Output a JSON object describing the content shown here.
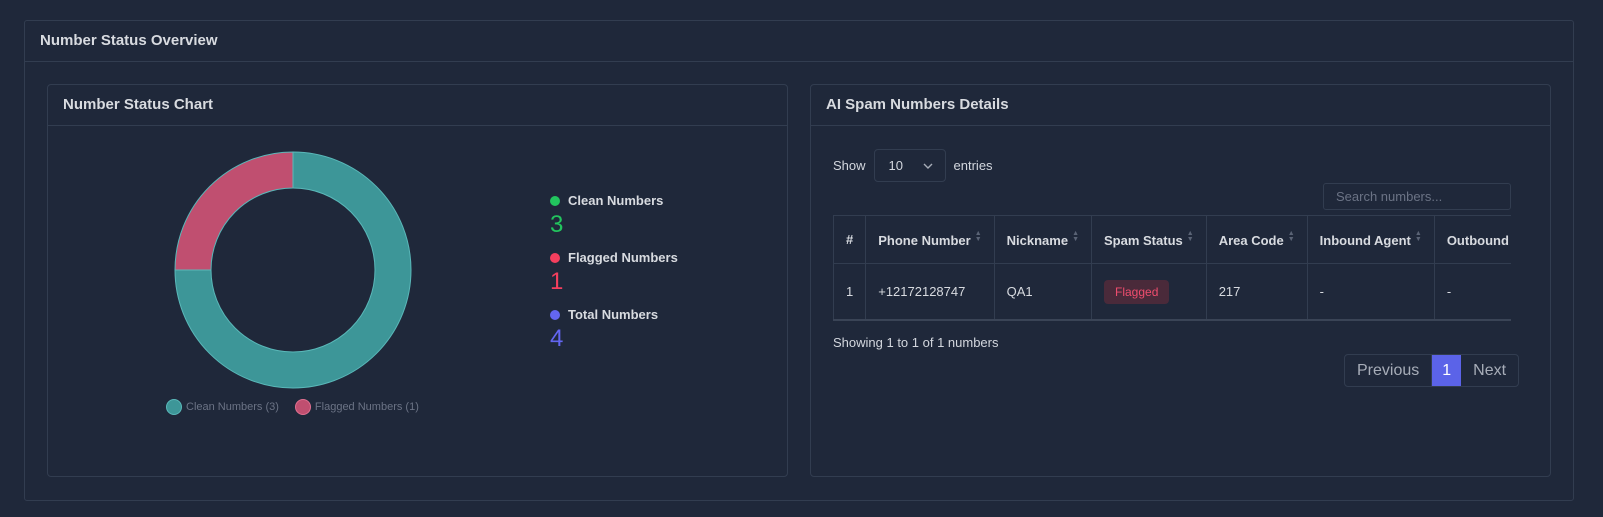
{
  "overview": {
    "title": "Number Status Overview"
  },
  "chart_card": {
    "title": "Number Status Chart",
    "legend": [
      {
        "label": "Clean Numbers (3)",
        "color": "#3d9698"
      },
      {
        "label": "Flagged Numbers (1)",
        "color": "#c04f70"
      }
    ]
  },
  "chart_data": {
    "type": "pie",
    "categories": [
      "Clean Numbers",
      "Flagged Numbers"
    ],
    "values": [
      3,
      1
    ],
    "colors": [
      "#3d9698",
      "#c04f70"
    ],
    "donut": true
  },
  "stats": [
    {
      "label": "Clean Numbers",
      "value": "3",
      "color": "#22c55e"
    },
    {
      "label": "Flagged Numbers",
      "value": "1",
      "color": "#f43f5e"
    },
    {
      "label": "Total Numbers",
      "value": "4",
      "color": "#6366f1"
    }
  ],
  "table_card": {
    "title": "AI Spam Numbers Details",
    "show_label": "Show",
    "entries_value": "10",
    "entries_label": "entries",
    "search_placeholder": "Search numbers...",
    "columns": [
      "#",
      "Phone Number",
      "Nickname",
      "Spam Status",
      "Area Code",
      "Inbound Agent",
      "Outbound Agent"
    ],
    "rows": [
      {
        "index": "1",
        "phone": "+12172128747",
        "nickname": "QA1",
        "status": "Flagged",
        "area_code": "217",
        "inbound": "-",
        "outbound": "-"
      }
    ],
    "info": "Showing 1 to 1 of 1 numbers",
    "pagination": {
      "previous": "Previous",
      "page": "1",
      "next": "Next"
    }
  }
}
